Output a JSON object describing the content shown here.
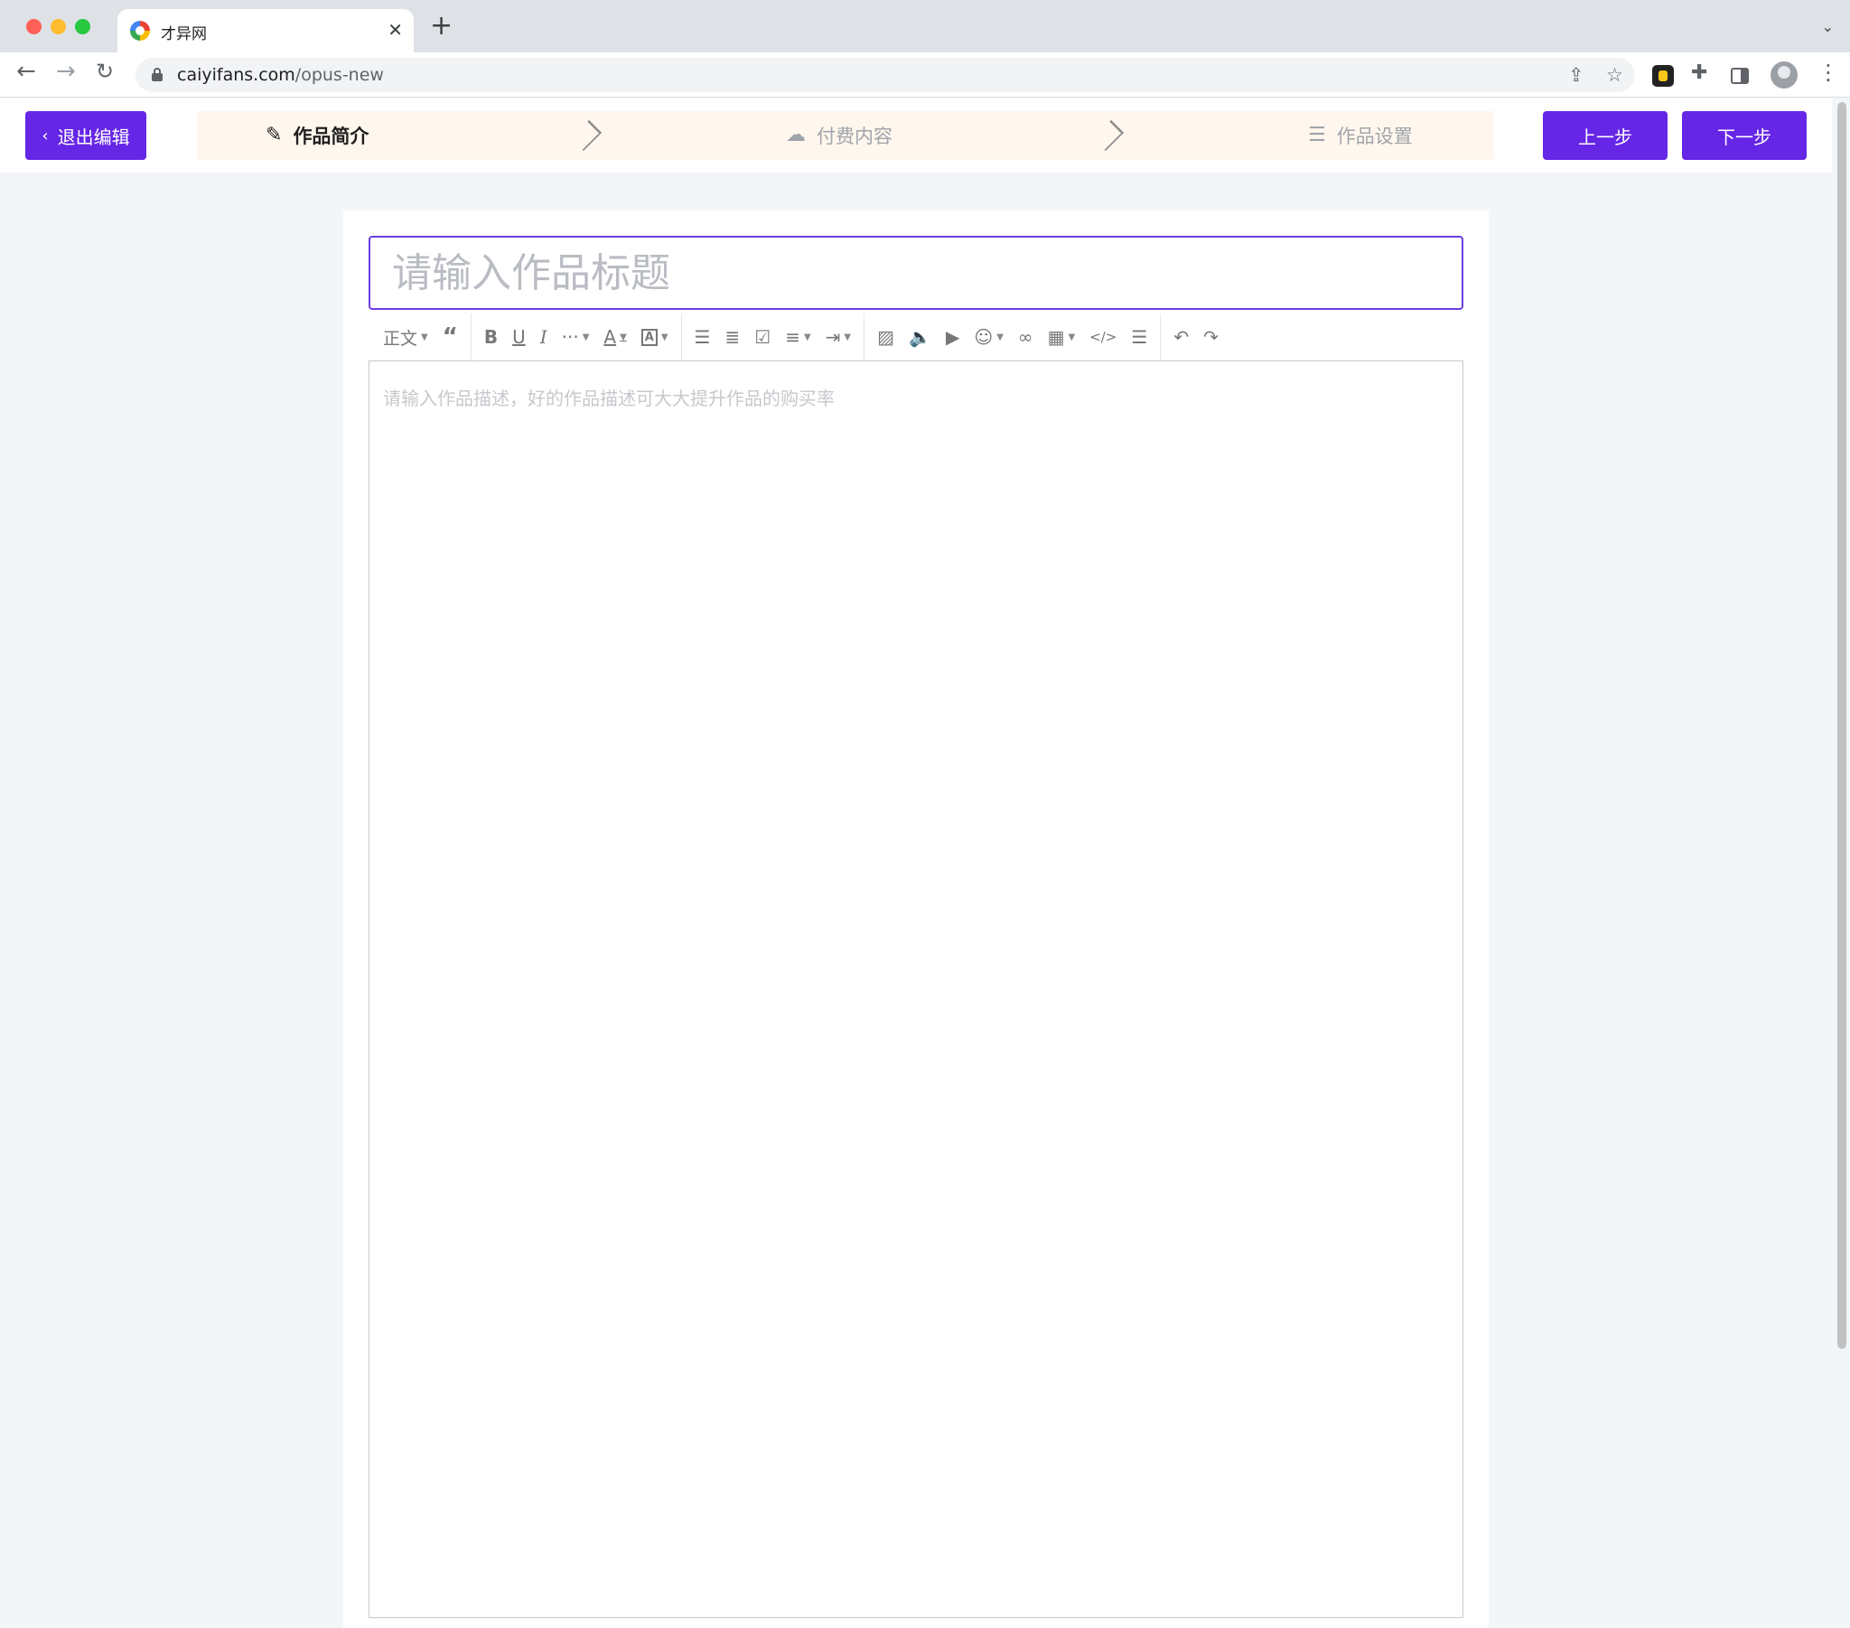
{
  "browser": {
    "tab_title": "才异网",
    "url_domain": "caiyifans.com",
    "url_path": "/opus-new"
  },
  "header": {
    "exit_label": "退出编辑",
    "steps": [
      {
        "label": "作品简介",
        "icon": "edit-icon",
        "active": true
      },
      {
        "label": "付费内容",
        "icon": "cloud-upload-icon",
        "active": false
      },
      {
        "label": "作品设置",
        "icon": "sliders-icon",
        "active": false
      }
    ],
    "prev_label": "上一步",
    "next_label": "下一步",
    "accent_color": "#6626e6"
  },
  "editor": {
    "title_placeholder": "请输入作品标题",
    "paragraph_style": "正文",
    "body_placeholder": "请输入作品描述，好的作品描述可大大提升作品的购买率"
  }
}
